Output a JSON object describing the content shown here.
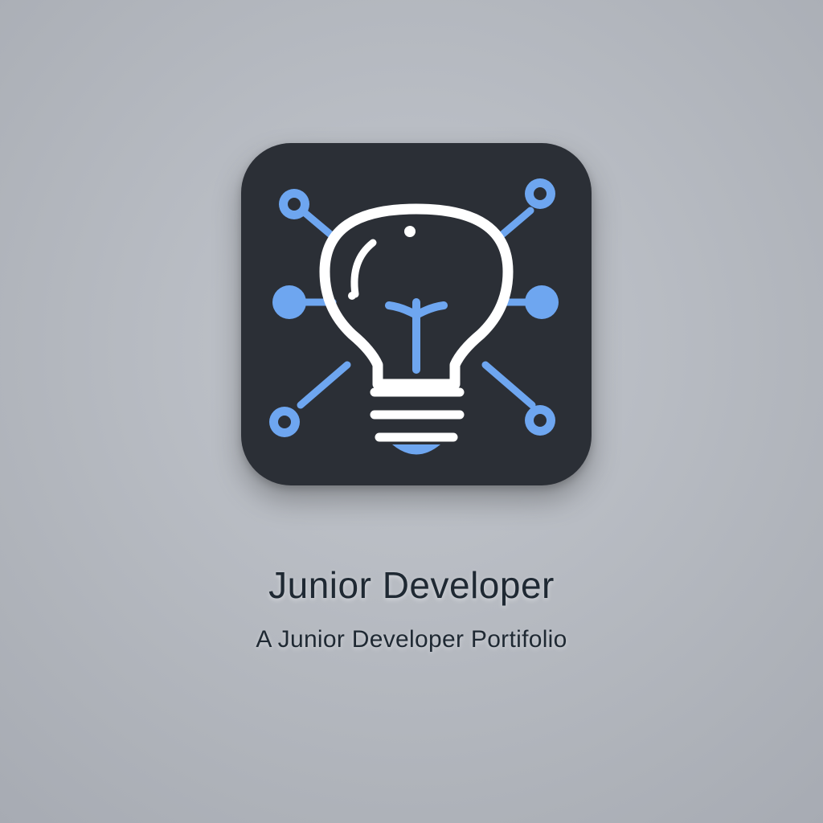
{
  "logo": {
    "icon": "lightbulb-network-icon",
    "colors": {
      "tile": "#2b2f36",
      "bulb_outline": "#ffffff",
      "accent": "#6ea6f0",
      "background": "#b9bdc4"
    }
  },
  "text": {
    "title": "Junior Developer",
    "subtitle": "A Junior Developer Portifolio"
  }
}
